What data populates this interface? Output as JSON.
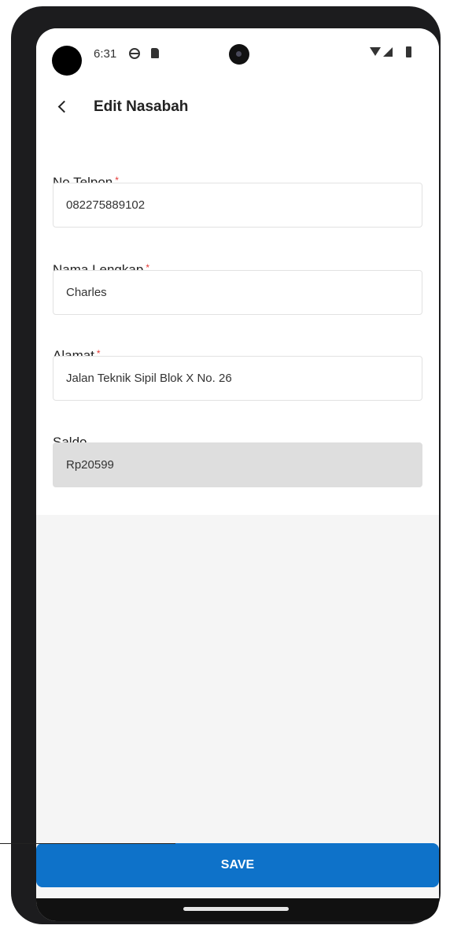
{
  "status_bar": {
    "time": "6:31",
    "icons": [
      "globe-icon",
      "sim-card-icon",
      "wifi-icon",
      "signal-icon",
      "battery-icon"
    ]
  },
  "app_bar": {
    "title": "Edit Nasabah",
    "back_icon": "chevron-left-icon"
  },
  "form": {
    "phone": {
      "label": "No Telpon",
      "required_mark": "*",
      "value": "082275889102"
    },
    "full_name": {
      "label": "Nama Lengkap",
      "required_mark": "*",
      "value": "Charles"
    },
    "address": {
      "label": "Alamat",
      "required_mark": "*",
      "value": "Jalan Teknik Sipil Blok X No. 26"
    },
    "balance": {
      "label": "Saldo",
      "value": "Rp20599"
    }
  },
  "actions": {
    "save_label": "SAVE"
  },
  "colors": {
    "primary": "#0e72c9",
    "required": "#e53935",
    "readonly_field": "#dedede",
    "phone_frame": "#1c1c1e"
  }
}
